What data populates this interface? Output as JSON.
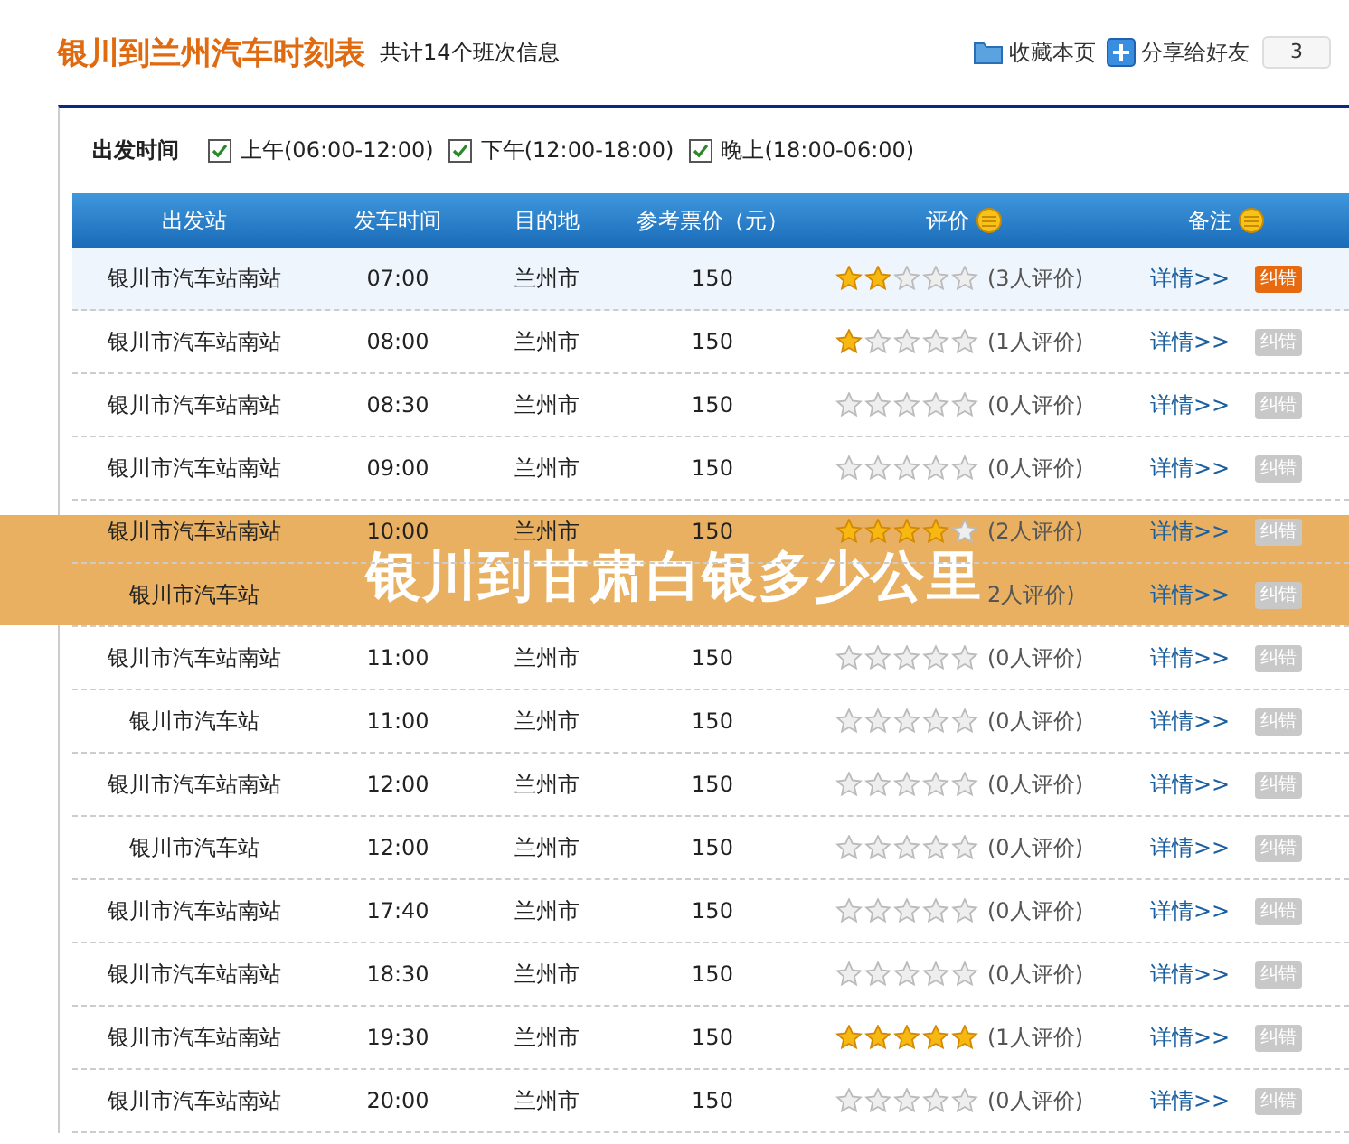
{
  "header": {
    "title": "银川到兰州汽车时刻表",
    "subtitle": "共计14个班次信息",
    "bookmark": "收藏本页",
    "share": "分享给好友",
    "share_count": "3"
  },
  "filter": {
    "label": "出发时间",
    "options": [
      {
        "label": "上午(06:00-12:00)",
        "checked": true
      },
      {
        "label": "下午(12:00-18:00)",
        "checked": true
      },
      {
        "label": "晚上(18:00-06:00)",
        "checked": true
      }
    ]
  },
  "table": {
    "columns": [
      {
        "label": "出发站",
        "coin": false
      },
      {
        "label": "发车时间",
        "coin": false
      },
      {
        "label": "目的地",
        "coin": false
      },
      {
        "label": "参考票价（元）",
        "coin": false
      },
      {
        "label": "评价",
        "coin": true
      },
      {
        "label": "备注",
        "coin": true
      }
    ],
    "rows": [
      {
        "station": "银川市汽车站南站",
        "time": "07:00",
        "destination": "兰州市",
        "price": "150",
        "stars": 2,
        "reviews": "(3人评价)",
        "detail": "详情>>",
        "report": "纠错",
        "report_active": true,
        "selected": true
      },
      {
        "station": "银川市汽车站南站",
        "time": "08:00",
        "destination": "兰州市",
        "price": "150",
        "stars": 1,
        "reviews": "(1人评价)",
        "detail": "详情>>",
        "report": "纠错",
        "report_active": false,
        "selected": false
      },
      {
        "station": "银川市汽车站南站",
        "time": "08:30",
        "destination": "兰州市",
        "price": "150",
        "stars": 0,
        "reviews": "(0人评价)",
        "detail": "详情>>",
        "report": "纠错",
        "report_active": false,
        "selected": false
      },
      {
        "station": "银川市汽车站南站",
        "time": "09:00",
        "destination": "兰州市",
        "price": "150",
        "stars": 0,
        "reviews": "(0人评价)",
        "detail": "详情>>",
        "report": "纠错",
        "report_active": false,
        "selected": false
      },
      {
        "station": "银川市汽车站南站",
        "time": "10:00",
        "destination": "兰州市",
        "price": "150",
        "stars": 4,
        "reviews": "(2人评价)",
        "detail": "详情>>",
        "report": "纠错",
        "report_active": false,
        "selected": false
      },
      {
        "station": "银川市汽车站",
        "reviews": "2人评价)",
        "detail": "详情>>",
        "report": "纠错",
        "report_active": false,
        "selected": false
      },
      {
        "station": "银川市汽车站南站",
        "time": "11:00",
        "destination": "兰州市",
        "price": "150",
        "stars": 0,
        "reviews": "(0人评价)",
        "detail": "详情>>",
        "report": "纠错",
        "report_active": false,
        "selected": false
      },
      {
        "station": "银川市汽车站",
        "time": "11:00",
        "destination": "兰州市",
        "price": "150",
        "stars": 0,
        "reviews": "(0人评价)",
        "detail": "详情>>",
        "report": "纠错",
        "report_active": false,
        "selected": false
      },
      {
        "station": "银川市汽车站南站",
        "time": "12:00",
        "destination": "兰州市",
        "price": "150",
        "stars": 0,
        "reviews": "(0人评价)",
        "detail": "详情>>",
        "report": "纠错",
        "report_active": false,
        "selected": false
      },
      {
        "station": "银川市汽车站",
        "time": "12:00",
        "destination": "兰州市",
        "price": "150",
        "stars": 0,
        "reviews": "(0人评价)",
        "detail": "详情>>",
        "report": "纠错",
        "report_active": false,
        "selected": false
      },
      {
        "station": "银川市汽车站南站",
        "time": "17:40",
        "destination": "兰州市",
        "price": "150",
        "stars": 0,
        "reviews": "(0人评价)",
        "detail": "详情>>",
        "report": "纠错",
        "report_active": false,
        "selected": false
      },
      {
        "station": "银川市汽车站南站",
        "time": "18:30",
        "destination": "兰州市",
        "price": "150",
        "stars": 0,
        "reviews": "(0人评价)",
        "detail": "详情>>",
        "report": "纠错",
        "report_active": false,
        "selected": false
      },
      {
        "station": "银川市汽车站南站",
        "time": "19:30",
        "destination": "兰州市",
        "price": "150",
        "stars": 5,
        "reviews": "(1人评价)",
        "detail": "详情>>",
        "report": "纠错",
        "report_active": false,
        "selected": false
      },
      {
        "station": "银川市汽车站南站",
        "time": "20:00",
        "destination": "兰州市",
        "price": "150",
        "stars": 0,
        "reviews": "(0人评价)",
        "detail": "详情>>",
        "report": "纠错",
        "report_active": false,
        "selected": false
      }
    ]
  },
  "overlay_title": "银川到甘肃白银多少公里"
}
